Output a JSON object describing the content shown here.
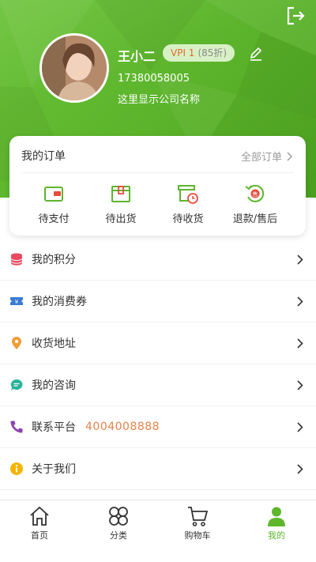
{
  "header": {
    "user_name": "王小二",
    "vip_level": "VPI 1",
    "vip_discount": "(85折)",
    "phone": "17380058005",
    "company": "这里显示公司名称"
  },
  "orders": {
    "title": "我的订单",
    "all_label": "全部订单",
    "items": [
      {
        "label": "待支付",
        "icon": "wallet-icon"
      },
      {
        "label": "待出货",
        "icon": "box-icon"
      },
      {
        "label": "待收货",
        "icon": "delivery-clock-icon"
      },
      {
        "label": "退款/售后",
        "icon": "refund-icon"
      }
    ]
  },
  "menu": [
    {
      "label": "我的积分",
      "icon": "database-icon",
      "color": "#e84a5f"
    },
    {
      "label": "我的消费券",
      "icon": "coupon-icon",
      "color": "#3a7bd5"
    },
    {
      "label": "收货地址",
      "icon": "location-pin-icon",
      "color": "#f39c34"
    },
    {
      "label": "我的咨询",
      "icon": "chat-icon",
      "color": "#2bb39a"
    },
    {
      "label": "联系平台",
      "icon": "phone-icon",
      "color": "#8e44ad",
      "extra": "4004008888"
    },
    {
      "label": "关于我们",
      "icon": "info-icon",
      "color": "#f5b400"
    }
  ],
  "tabs": [
    {
      "label": "首页",
      "icon": "home-icon",
      "active": false
    },
    {
      "label": "分类",
      "icon": "category-icon",
      "active": false
    },
    {
      "label": "购物车",
      "icon": "cart-icon",
      "active": false
    },
    {
      "label": "我的",
      "icon": "user-icon",
      "active": true
    }
  ],
  "colors": {
    "brand_green": "#5db62c",
    "price_orange": "#e8834a"
  }
}
